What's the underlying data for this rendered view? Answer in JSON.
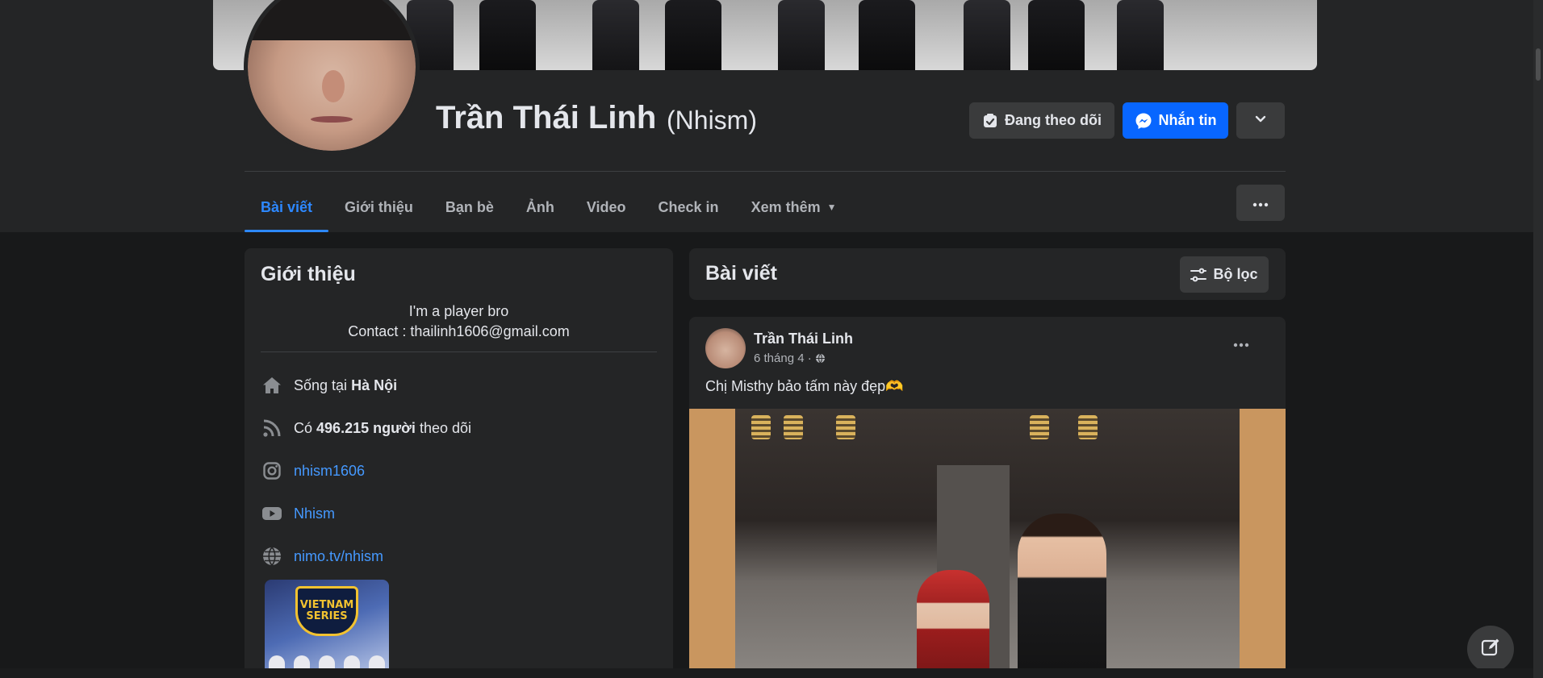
{
  "profile": {
    "name": "Trần Thái Linh",
    "nickname": "(Nhism)"
  },
  "actions": {
    "follow_label": "Đang theo dõi",
    "message_label": "Nhắn tin"
  },
  "tabs": [
    {
      "label": "Bài viết",
      "active": true
    },
    {
      "label": "Giới thiệu"
    },
    {
      "label": "Bạn bè"
    },
    {
      "label": "Ảnh"
    },
    {
      "label": "Video"
    },
    {
      "label": "Check in"
    },
    {
      "label": "Xem thêm"
    }
  ],
  "intro": {
    "title": "Giới thiệu",
    "bio_line1": "I'm a player bro",
    "bio_line2": "Contact : thailinh1606@gmail.com",
    "lives_prefix": "Sống tại ",
    "lives_city": "Hà Nội",
    "followers_prefix": "Có ",
    "followers_count": "496.215 người",
    "followers_suffix": " theo dõi",
    "instagram": "nhism1606",
    "youtube": "Nhism",
    "website": "nimo.tv/nhism",
    "thumb_text_1": "VIETNAM",
    "thumb_text_2": "SERIES"
  },
  "posts": {
    "title": "Bài viết",
    "filter_label": "Bộ lọc",
    "items": [
      {
        "author": "Trần Thái Linh",
        "date": "6 tháng 4 ·",
        "text": "Chị Misthy bảo tấm này đẹp🫶"
      }
    ]
  },
  "icons": {
    "home": "home-icon",
    "rss": "rss-icon",
    "instagram": "instagram-icon",
    "youtube": "youtube-icon",
    "globe": "globe-icon",
    "messenger": "messenger-icon",
    "follow": "follow-check-icon",
    "filter": "filter-icon",
    "compose": "compose-icon"
  },
  "colors": {
    "accent": "#0866ff",
    "link": "#4599ff",
    "background": "#18191a",
    "card": "#242526"
  }
}
